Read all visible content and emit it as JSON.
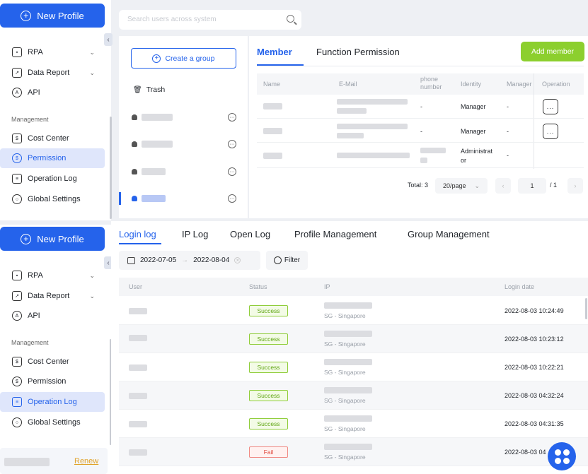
{
  "sidebar_top": {
    "new_profile": "New Profile",
    "items": [
      {
        "label": "RPA",
        "icon": "robot-icon",
        "has_chevron": true
      },
      {
        "label": "Data Report",
        "icon": "chart-icon",
        "has_chevron": true
      },
      {
        "label": "API",
        "icon": "api-icon",
        "has_chevron": false
      }
    ],
    "section": "Management",
    "management": [
      {
        "label": "Cost Center",
        "icon": "dollar-icon"
      },
      {
        "label": "Permission",
        "icon": "shield-icon",
        "active": true
      },
      {
        "label": "Operation Log",
        "icon": "log-icon"
      },
      {
        "label": "Global Settings",
        "icon": "settings-icon"
      }
    ]
  },
  "sidebar_bottom": {
    "new_profile": "New Profile",
    "items": [
      {
        "label": "RPA"
      },
      {
        "label": "Data Report"
      },
      {
        "label": "API"
      }
    ],
    "section": "Management",
    "management": [
      {
        "label": "Cost Center"
      },
      {
        "label": "Permission"
      },
      {
        "label": "Operation Log",
        "active": true
      },
      {
        "label": "Global Settings"
      }
    ],
    "renew": "Renew"
  },
  "search": {
    "placeholder": "Search users across system"
  },
  "groups": {
    "create_label": "Create a group",
    "trash_label": "Trash"
  },
  "permission_tabs": {
    "member": "Member",
    "function": "Function Permission",
    "add_member": "Add member"
  },
  "member_table": {
    "headers": [
      "Name",
      "E-Mail",
      "phone number",
      "Identity",
      "Manager",
      "Operation"
    ],
    "rows": [
      {
        "phone": "-",
        "identity": "Manager",
        "manager": "-",
        "op": "..."
      },
      {
        "phone": "-",
        "identity": "Manager",
        "manager": "-",
        "op": "..."
      },
      {
        "phone": "",
        "identity": "Administrator",
        "manager": "-",
        "op": ""
      }
    ]
  },
  "pagination": {
    "total": "Total: 3",
    "page_size": "20/page",
    "page": "1",
    "pages": "/ 1"
  },
  "log_tabs": [
    "Login log",
    "IP Log",
    "Open Log",
    "Profile Management",
    "Group Management"
  ],
  "log_filter": {
    "start": "2022-07-05",
    "end": "2022-08-04",
    "filter_label": "Filter"
  },
  "log_table": {
    "headers": [
      "User",
      "Status",
      "IP",
      "Login date"
    ],
    "rows": [
      {
        "status": "Success",
        "ip_location": "SG - Singapore",
        "date": "2022-08-03 10:24:49"
      },
      {
        "status": "Success",
        "ip_location": "SG - Singapore",
        "date": "2022-08-03 10:23:12"
      },
      {
        "status": "Success",
        "ip_location": "SG - Singapore",
        "date": "2022-08-03 10:22:21"
      },
      {
        "status": "Success",
        "ip_location": "SG - Singapore",
        "date": "2022-08-03 04:32:24"
      },
      {
        "status": "Success",
        "ip_location": "SG - Singapore",
        "date": "2022-08-03 04:31:35"
      },
      {
        "status": "Fail",
        "ip_location": "SG - Singapore",
        "date": "2022-08-03 04"
      }
    ]
  },
  "colors": {
    "accent": "#2563eb",
    "add_member": "#8ccf2e",
    "success": "#5fa512",
    "fail": "#e24a3f"
  }
}
